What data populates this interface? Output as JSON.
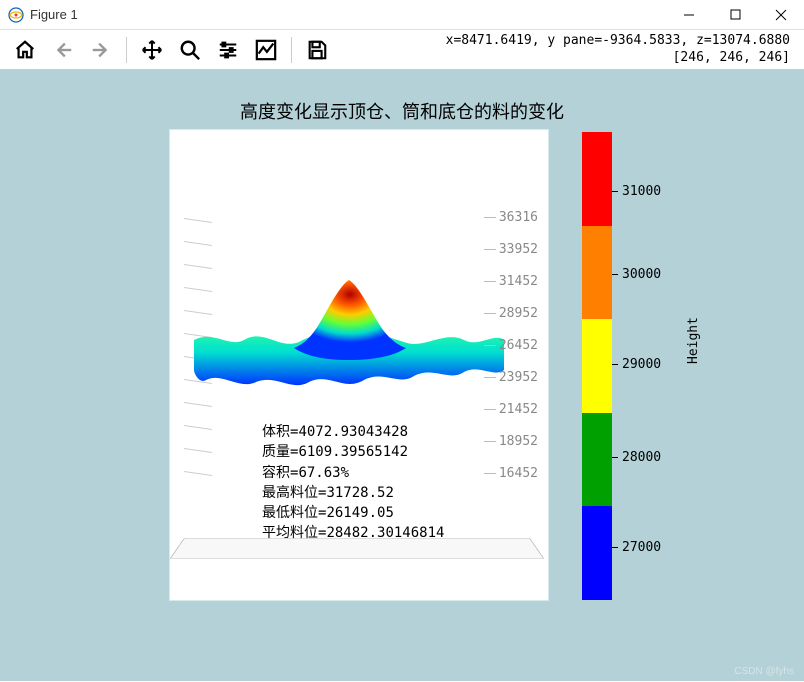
{
  "window": {
    "title": "Figure 1",
    "minimize": "–",
    "maximize": "□",
    "close": "×"
  },
  "toolbar": {
    "status_line1": "x=8471.6419, y pane=-9364.5833, z=13074.6880",
    "status_line2": "[246, 246, 246]"
  },
  "chart_data": {
    "type": "surface3d",
    "title": "高度变化显示顶仓、筒和底仓的料的变化",
    "z_ticks": [
      36316,
      33952,
      31452,
      28952,
      26452,
      23952,
      21452,
      18952,
      16452
    ],
    "colorbar": {
      "label": "Height",
      "ticks": [
        31000,
        30000,
        29000,
        28000,
        27000
      ],
      "segments": [
        {
          "color": "#ff0000"
        },
        {
          "color": "#ff8000"
        },
        {
          "color": "#ffff00"
        },
        {
          "color": "#00a000"
        },
        {
          "color": "#0000ff"
        }
      ]
    },
    "stats": {
      "volume_label": "体积=",
      "volume": "4072.93043428",
      "mass_label": "质量=",
      "mass": "6109.39565142",
      "capacity_label": "容积=",
      "capacity": "67.63%",
      "max_label": "最高料位=",
      "max": "31728.52",
      "min_label": "最低料位=",
      "min": "26149.05",
      "avg_label": "平均料位=",
      "avg": "28482.30146814"
    },
    "cursor": {
      "x": 8471.6419,
      "y": -9364.5833,
      "z": 13074.688,
      "rgb": [
        246,
        246,
        246
      ]
    }
  },
  "watermark": "CSDN @fyhs"
}
